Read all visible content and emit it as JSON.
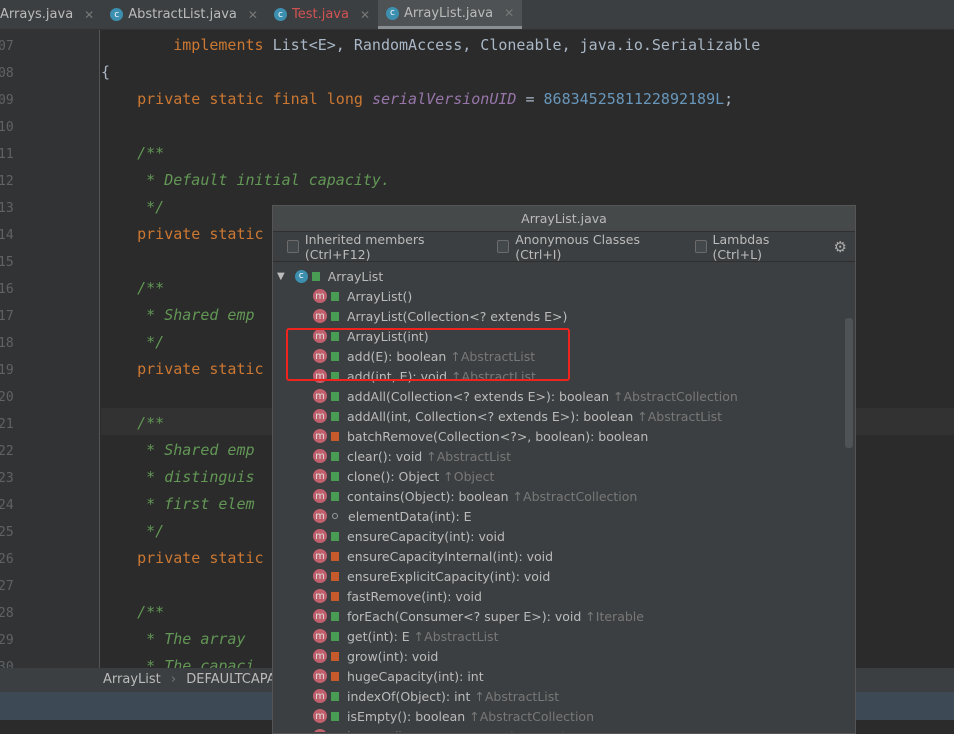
{
  "tabs": [
    {
      "label": "Arrays.java",
      "icon": "class-icon"
    },
    {
      "label": "AbstractList.java",
      "icon": "abstract-class-icon"
    },
    {
      "label": "Test.java",
      "icon": "runnable-class-icon",
      "color": "#d25252"
    },
    {
      "label": "ArrayList.java",
      "icon": "class-icon",
      "active": true
    }
  ],
  "lines": [
    {
      "n": "07",
      "html": "        <span class='kw'>implements</span> List&lt;E&gt;, RandomAccess, Cloneable, java.io.Serializable"
    },
    {
      "n": "08",
      "html": "{"
    },
    {
      "n": "09",
      "html": "    <span class='kw'>private static final long</span> <span class='it'>serialVersionUID</span> = <span class='num'>8683452581122892189L</span>;"
    },
    {
      "n": "10",
      "html": ""
    },
    {
      "n": "11",
      "html": "    <span class='cm'>/**</span>"
    },
    {
      "n": "12",
      "html": "<span class='cm'>     * Default initial capacity.</span>"
    },
    {
      "n": "13",
      "html": "<span class='cm'>     */</span>"
    },
    {
      "n": "14",
      "html": "    <span class='kw'>private static</span>"
    },
    {
      "n": "15",
      "html": ""
    },
    {
      "n": "16",
      "html": "    <span class='cm'>/**</span>"
    },
    {
      "n": "17",
      "html": "<span class='cm'>     * Shared emp</span>"
    },
    {
      "n": "18",
      "html": "<span class='cm'>     */</span>"
    },
    {
      "n": "19",
      "html": "    <span class='kw'>private static</span>"
    },
    {
      "n": "20",
      "html": ""
    },
    {
      "n": "21",
      "html": "    <span class='cm'>/**</span>"
    },
    {
      "n": "22",
      "html": "<span class='cm'>     * Shared emp                                              We</span>"
    },
    {
      "n": "23",
      "html": "<span class='cm'>     * distinguis                                              when</span>"
    },
    {
      "n": "24",
      "html": "<span class='cm'>     * first elem</span>"
    },
    {
      "n": "25",
      "html": "<span class='cm'>     */</span>"
    },
    {
      "n": "26",
      "html": "    <span class='kw'>private static</span>"
    },
    {
      "n": "27",
      "html": ""
    },
    {
      "n": "28",
      "html": "    <span class='cm'>/**</span>"
    },
    {
      "n": "29",
      "html": "<span class='cm'>     * The array </span>"
    },
    {
      "n": "30",
      "html": "<span class='cm'>     * The capaci</span>"
    }
  ],
  "breadcrumb": [
    "ArrayList",
    "DEFAULTCAPACI"
  ],
  "popup": {
    "title": "ArrayList.java",
    "options": [
      "Inherited members (Ctrl+F12)",
      "Anonymous Classes (Ctrl+I)",
      "Lambdas (Ctrl+L)"
    ],
    "root": "ArrayList",
    "members": [
      {
        "sig": "ArrayList()",
        "vis": "pub"
      },
      {
        "sig": "ArrayList(Collection<? extends E>)",
        "vis": "pub"
      },
      {
        "sig": "ArrayList(int)",
        "vis": "pub"
      },
      {
        "sig": "add(E): boolean",
        "vis": "pub",
        "from": "↑AbstractList"
      },
      {
        "sig": "add(int, E): void",
        "vis": "pub",
        "from": "↑AbstractList"
      },
      {
        "sig": "addAll(Collection<? extends E>): boolean",
        "vis": "pub",
        "from": "↑AbstractCollection"
      },
      {
        "sig": "addAll(int, Collection<? extends E>): boolean",
        "vis": "pub",
        "from": "↑AbstractList"
      },
      {
        "sig": "batchRemove(Collection<?>, boolean): boolean",
        "vis": "priv"
      },
      {
        "sig": "clear(): void",
        "vis": "pub",
        "from": "↑AbstractList"
      },
      {
        "sig": "clone(): Object",
        "vis": "pub",
        "from": "↑Object"
      },
      {
        "sig": "contains(Object): boolean",
        "vis": "pub",
        "from": "↑AbstractCollection"
      },
      {
        "sig": "elementData(int): E",
        "vis": "pkg"
      },
      {
        "sig": "ensureCapacity(int): void",
        "vis": "pub"
      },
      {
        "sig": "ensureCapacityInternal(int): void",
        "vis": "priv"
      },
      {
        "sig": "ensureExplicitCapacity(int): void",
        "vis": "priv"
      },
      {
        "sig": "fastRemove(int): void",
        "vis": "priv"
      },
      {
        "sig": "forEach(Consumer<? super E>): void",
        "vis": "pub",
        "from": "↑Iterable"
      },
      {
        "sig": "get(int): E",
        "vis": "pub",
        "from": "↑AbstractList"
      },
      {
        "sig": "grow(int): void",
        "vis": "priv"
      },
      {
        "sig": "hugeCapacity(int): int",
        "vis": "priv"
      },
      {
        "sig": "indexOf(Object): int",
        "vis": "pub",
        "from": "↑AbstractList"
      },
      {
        "sig": "isEmpty(): boolean",
        "vis": "pub",
        "from": "↑AbstractCollection"
      },
      {
        "sig": "iterator(): Iterator<E>",
        "vis": "pub",
        "from": "↑AbstractList"
      }
    ]
  },
  "colors": {
    "highlight": "#f0241e",
    "method": "#c0606c",
    "public": "#499c54",
    "private": "#c75a2a"
  }
}
